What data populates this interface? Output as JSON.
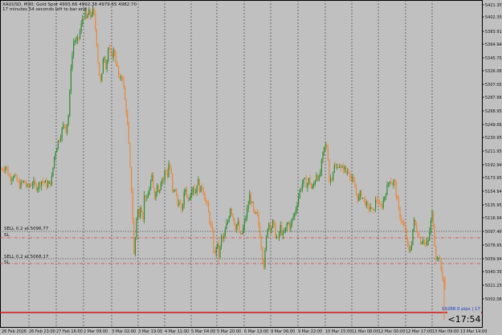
{
  "header": {
    "line1": "XAUUSD, M30: Gold Spot 4993.66 4992.38 4979.65 4982.70",
    "line2": "17 minutes 54 seconds left to bar end"
  },
  "colors": {
    "background": "#c0c0c0",
    "bull": "#2e8b2e",
    "bear": "#e8873a",
    "grid": "#333333",
    "sell_line": "#555555",
    "sl_line": "#d04040",
    "current_line": "#d01818",
    "tp_label": "#1a3cc8"
  },
  "orders": [
    {
      "label": "SELL 0.2 at 5096.77",
      "sl_label": "SL"
    },
    {
      "label": "SELL 0.2 at 5068.17",
      "sl_label": "SL"
    }
  ],
  "current": {
    "label": "19288.0 pips | 17",
    "timer": "<17:54"
  },
  "chart_data": {
    "type": "candlestick",
    "title": "XAUUSD, M30: Gold Spot 4993.66 4992.38 4979.65 4982.70",
    "ylim": [
      5040.0,
      5424.0
    ],
    "y_ticks": [
      "5421.35",
      "5402.35",
      "5383.91",
      "5364.94",
      "5345.75",
      "5326.06",
      "5307.05",
      "5287.96",
      "5268.95",
      "5249.06",
      "5230.95",
      "5211.95",
      "5192.94",
      "5173.95",
      "5154.94",
      "5135.95",
      "5116.94",
      "5097.46",
      "5078.95",
      "5059.94",
      "5040.35",
      "5021.25",
      "5002.06"
    ],
    "x_ticks": [
      "26 Feb 2026",
      "26 Feb 23:00",
      "27 Feb 16:00",
      "2 Mar 09:00",
      "3 Mar 02:00",
      "3 Mar 19:00",
      "4 Mar 11:00",
      "5 Mar 04:00",
      "5 Mar 20:00",
      "6 Mar 13:00",
      "9 Mar 06:00",
      "9 Mar 22:00",
      "10 Mar 15:00",
      "11 Mar 08:00",
      "12 Mar 00:00",
      "12 Mar 17:00",
      "13 Mar 09:00",
      "13 Mar 14:00"
    ],
    "levels": {
      "sell1": 5096.77,
      "sl1": 5090.5,
      "sell2": 5068.17,
      "sl2": 5064.0,
      "current": 4982.7
    },
    "close_path": [
      [
        0,
        5190
      ],
      [
        5,
        5195
      ],
      [
        10,
        5178
      ],
      [
        15,
        5183
      ],
      [
        22,
        5168
      ],
      [
        28,
        5174
      ],
      [
        32,
        5165
      ],
      [
        38,
        5172
      ],
      [
        44,
        5166
      ],
      [
        50,
        5175
      ],
      [
        57,
        5168
      ],
      [
        62,
        5174
      ],
      [
        66,
        5212
      ],
      [
        70,
        5228
      ],
      [
        74,
        5240
      ],
      [
        78,
        5255
      ],
      [
        80,
        5245
      ],
      [
        84,
        5270
      ],
      [
        86,
        5330
      ],
      [
        88,
        5348
      ],
      [
        90,
        5370
      ],
      [
        93,
        5365
      ],
      [
        96,
        5372
      ],
      [
        98,
        5382
      ],
      [
        101,
        5400
      ],
      [
        104,
        5405
      ],
      [
        106,
        5395
      ],
      [
        108,
        5409
      ],
      [
        111,
        5400
      ],
      [
        113,
        5412
      ],
      [
        115,
        5403
      ],
      [
        118,
        5372
      ],
      [
        121,
        5325
      ],
      [
        124,
        5305
      ],
      [
        127,
        5355
      ],
      [
        130,
        5330
      ],
      [
        133,
        5360
      ],
      [
        136,
        5345
      ],
      [
        140,
        5355
      ],
      [
        144,
        5330
      ],
      [
        147,
        5310
      ],
      [
        150,
        5325
      ],
      [
        153,
        5290
      ],
      [
        156,
        5265
      ],
      [
        158,
        5230
      ],
      [
        160,
        5190
      ],
      [
        162,
        5155
      ],
      [
        164,
        5100
      ],
      [
        165,
        5065
      ],
      [
        167,
        5110
      ],
      [
        169,
        5140
      ],
      [
        171,
        5120
      ],
      [
        173,
        5145
      ],
      [
        176,
        5125
      ],
      [
        178,
        5160
      ],
      [
        181,
        5145
      ],
      [
        184,
        5165
      ],
      [
        187,
        5180
      ],
      [
        190,
        5150
      ],
      [
        193,
        5170
      ],
      [
        196,
        5160
      ],
      [
        199,
        5180
      ],
      [
        202,
        5175
      ],
      [
        204,
        5195
      ],
      [
        206,
        5178
      ],
      [
        208,
        5198
      ],
      [
        211,
        5185
      ],
      [
        213,
        5155
      ],
      [
        216,
        5165
      ],
      [
        219,
        5140
      ],
      [
        221,
        5150
      ],
      [
        224,
        5130
      ],
      [
        226,
        5148
      ],
      [
        229,
        5165
      ],
      [
        232,
        5148
      ],
      [
        235,
        5158
      ],
      [
        238,
        5170
      ],
      [
        241,
        5155
      ],
      [
        244,
        5178
      ],
      [
        247,
        5160
      ],
      [
        250,
        5168
      ],
      [
        253,
        5150
      ],
      [
        256,
        5140
      ],
      [
        259,
        5120
      ],
      [
        262,
        5105
      ],
      [
        264,
        5080
      ],
      [
        266,
        5070
      ],
      [
        268,
        5095
      ],
      [
        270,
        5068
      ],
      [
        272,
        5082
      ],
      [
        274,
        5100
      ],
      [
        276,
        5090
      ],
      [
        279,
        5110
      ],
      [
        282,
        5120
      ],
      [
        285,
        5140
      ],
      [
        288,
        5125
      ],
      [
        291,
        5110
      ],
      [
        294,
        5118
      ],
      [
        297,
        5095
      ],
      [
        300,
        5105
      ],
      [
        303,
        5120
      ],
      [
        306,
        5135
      ],
      [
        309,
        5155
      ],
      [
        312,
        5140
      ],
      [
        315,
        5125
      ],
      [
        318,
        5130
      ],
      [
        321,
        5105
      ],
      [
        324,
        5080
      ],
      [
        326,
        5055
      ],
      [
        328,
        5075
      ],
      [
        330,
        5100
      ],
      [
        332,
        5120
      ],
      [
        335,
        5108
      ],
      [
        338,
        5118
      ],
      [
        341,
        5100
      ],
      [
        344,
        5092
      ],
      [
        347,
        5112
      ],
      [
        350,
        5098
      ],
      [
        353,
        5105
      ],
      [
        356,
        5118
      ],
      [
        359,
        5110
      ],
      [
        362,
        5122
      ],
      [
        365,
        5130
      ],
      [
        368,
        5145
      ],
      [
        371,
        5160
      ],
      [
        374,
        5170
      ],
      [
        377,
        5175
      ],
      [
        380,
        5168
      ],
      [
        383,
        5178
      ],
      [
        386,
        5162
      ],
      [
        389,
        5170
      ],
      [
        392,
        5185
      ],
      [
        395,
        5175
      ],
      [
        398,
        5195
      ],
      [
        401,
        5218
      ],
      [
        404,
        5225
      ],
      [
        406,
        5215
      ],
      [
        408,
        5175
      ],
      [
        411,
        5180
      ],
      [
        414,
        5195
      ],
      [
        417,
        5190
      ],
      [
        420,
        5200
      ],
      [
        423,
        5188
      ],
      [
        426,
        5195
      ],
      [
        429,
        5185
      ],
      [
        432,
        5190
      ],
      [
        435,
        5178
      ],
      [
        438,
        5172
      ],
      [
        441,
        5160
      ],
      [
        444,
        5148
      ],
      [
        447,
        5158
      ],
      [
        450,
        5150
      ],
      [
        453,
        5145
      ],
      [
        456,
        5135
      ],
      [
        459,
        5140
      ],
      [
        462,
        5128
      ],
      [
        465,
        5145
      ],
      [
        468,
        5150
      ],
      [
        471,
        5135
      ],
      [
        474,
        5142
      ],
      [
        477,
        5155
      ],
      [
        480,
        5165
      ],
      [
        483,
        5178
      ],
      [
        486,
        5170
      ],
      [
        489,
        5175
      ],
      [
        492,
        5150
      ],
      [
        495,
        5130
      ],
      [
        498,
        5120
      ],
      [
        501,
        5110
      ],
      [
        504,
        5095
      ],
      [
        507,
        5075
      ],
      [
        510,
        5085
      ],
      [
        513,
        5120
      ],
      [
        516,
        5110
      ],
      [
        519,
        5100
      ],
      [
        522,
        5090
      ],
      [
        525,
        5096
      ],
      [
        528,
        5085
      ],
      [
        531,
        5090
      ],
      [
        534,
        5115
      ],
      [
        536,
        5130
      ],
      [
        538,
        5110
      ],
      [
        540,
        5075
      ],
      [
        542,
        5065
      ],
      [
        544,
        5072
      ],
      [
        546,
        5060
      ],
      [
        548,
        5048
      ],
      [
        550,
        5040
      ],
      [
        552,
        5025
      ],
      [
        553,
        4982.7
      ]
    ]
  }
}
